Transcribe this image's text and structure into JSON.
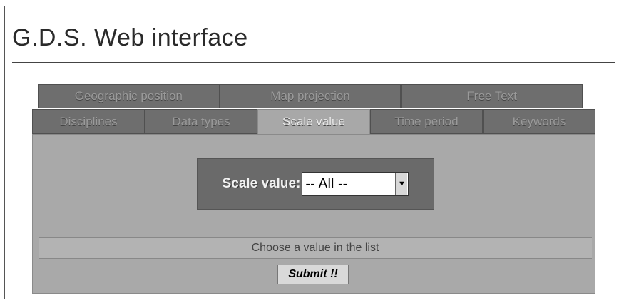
{
  "header": {
    "title": "G.D.S. Web interface"
  },
  "tabs_top": [
    {
      "label": "Geographic position"
    },
    {
      "label": "Map projection"
    },
    {
      "label": "Free Text"
    }
  ],
  "tabs_bottom": [
    {
      "label": "Disciplines"
    },
    {
      "label": "Data types"
    },
    {
      "label": "Scale value",
      "active": true
    },
    {
      "label": "Time period"
    },
    {
      "label": "Keywords"
    }
  ],
  "form": {
    "scale_label": "Scale value:",
    "select_value": "-- All --",
    "hint": "Choose a value in the list",
    "submit_label": "Submit !!"
  }
}
